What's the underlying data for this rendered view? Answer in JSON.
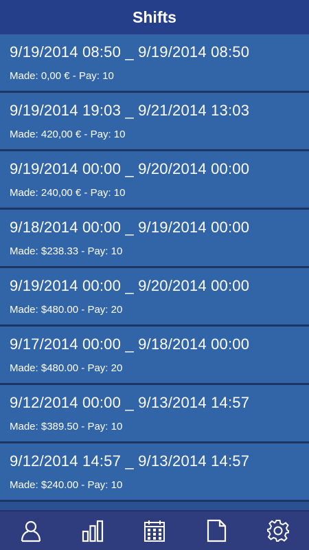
{
  "header": {
    "title": "Shifts"
  },
  "shifts": [
    {
      "range": "9/19/2014 08:50 _ 9/19/2014 08:50",
      "made_label": "Made:",
      "made": "0,00 €",
      "pay_label": "Pay:",
      "pay": "10"
    },
    {
      "range": "9/19/2014 19:03 _ 9/21/2014 13:03",
      "made_label": "Made:",
      "made": "420,00 €",
      "pay_label": "Pay:",
      "pay": "10"
    },
    {
      "range": "9/19/2014 00:00 _ 9/20/2014 00:00",
      "made_label": "Made:",
      "made": "240,00 €",
      "pay_label": "Pay:",
      "pay": "10"
    },
    {
      "range": "9/18/2014 00:00 _ 9/19/2014 00:00",
      "made_label": "Made:",
      "made": "$238.33",
      "pay_label": "Pay:",
      "pay": "10"
    },
    {
      "range": "9/19/2014 00:00 _ 9/20/2014 00:00",
      "made_label": "Made:",
      "made": "$480.00",
      "pay_label": "Pay:",
      "pay": "20"
    },
    {
      "range": "9/17/2014 00:00 _ 9/18/2014 00:00",
      "made_label": "Made:",
      "made": "$480.00",
      "pay_label": "Pay:",
      "pay": "20"
    },
    {
      "range": "9/12/2014 00:00 _ 9/13/2014 14:57",
      "made_label": "Made:",
      "made": "$389.50",
      "pay_label": "Pay:",
      "pay": "10"
    },
    {
      "range": "9/12/2014 14:57 _ 9/13/2014 14:57",
      "made_label": "Made:",
      "made": "$240.00",
      "pay_label": "Pay:",
      "pay": "10"
    }
  ],
  "tabbar": {
    "items": [
      {
        "icon": "person-icon"
      },
      {
        "icon": "bar-chart-icon"
      },
      {
        "icon": "calendar-icon"
      },
      {
        "icon": "document-icon"
      },
      {
        "icon": "gear-icon"
      }
    ]
  },
  "colors": {
    "header_bg": "#263f8a",
    "row_bg": "#3264a8",
    "row_divider": "#1c3563",
    "tabbar_bg": "#2f3c7e",
    "text": "#ffffff"
  }
}
